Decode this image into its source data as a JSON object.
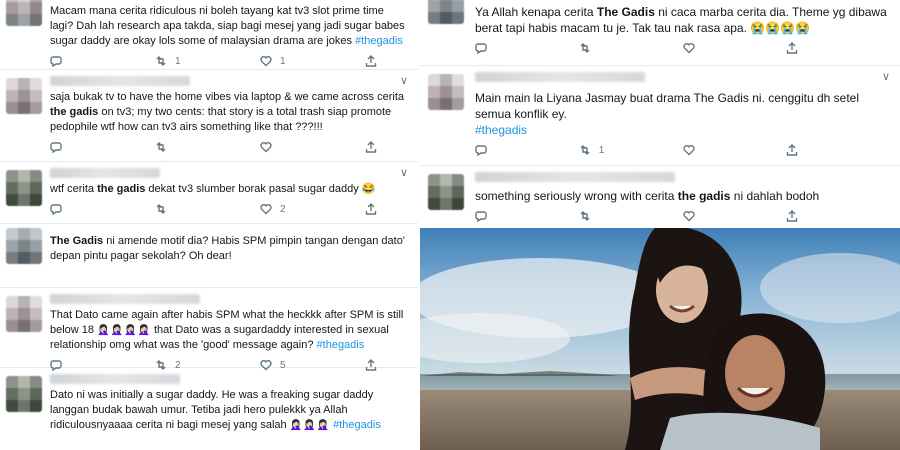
{
  "left_tweets": [
    {
      "id": "t1",
      "segments": [
        {
          "t": "Macam mana cerita ridiculous ni boleh tayang kat tv3 slot prime time lagi? Dah lah research apa takda, siap bagi mesej yang jadi sugar babes sugar daddy are okay lols some of malaysian drama are jokes ",
          "s": "plain"
        },
        {
          "t": "#thegadis",
          "s": "tag"
        }
      ],
      "retweets": "1",
      "likes": "1"
    },
    {
      "id": "t2",
      "segments": [
        {
          "t": "saja bukak tv to have the home vibes via laptop & we came across cerita ",
          "s": "plain"
        },
        {
          "t": "the gadis",
          "s": "bold"
        },
        {
          "t": " on tv3; my two cents: that story is a total trash siap promote pedophile wtf how can tv3 airs something like that ???!!!",
          "s": "plain"
        }
      ],
      "retweets": "",
      "likes": ""
    },
    {
      "id": "t3",
      "segments": [
        {
          "t": "wtf cerita ",
          "s": "plain"
        },
        {
          "t": "the gadis",
          "s": "bold"
        },
        {
          "t": " dekat tv3 slumber borak pasal sugar daddy ",
          "s": "plain"
        },
        {
          "t": "😂",
          "s": "plain"
        }
      ],
      "retweets": "",
      "likes": "2"
    },
    {
      "id": "t4",
      "segments": [
        {
          "t": "The Gadis",
          "s": "bold"
        },
        {
          "t": " ni amende motif dia? Habis SPM pimpin tangan dengan dato' depan pintu pagar sekolah? Oh dear!",
          "s": "plain"
        }
      ],
      "retweets": "",
      "likes": ""
    },
    {
      "id": "t5",
      "segments": [
        {
          "t": "That Dato came again after habis SPM what the heckkk after SPM is still below 18 ",
          "s": "plain"
        },
        {
          "t": "🤦🏻‍♀️🤦🏻‍♀️🤦🏻‍♀️🤦🏻‍♀️",
          "s": "emo"
        },
        {
          "t": " that Dato was a sugardaddy interested in sexual relationship omg what was the 'good' message again? ",
          "s": "plain"
        },
        {
          "t": "#thegadis",
          "s": "tag"
        }
      ],
      "retweets": "2",
      "likes": "5"
    },
    {
      "id": "t6",
      "segments": [
        {
          "t": "Dato ni was initially a sugar daddy. He was a freaking sugar daddy langgan budak bawah umur. Tetiba jadi hero pulekkk ya Allah ridiculousnyaaaa cerita ni bagi mesej yang salah ",
          "s": "plain"
        },
        {
          "t": "🤦🏻‍♀️🤦🏻‍♀️🤦🏻‍♀️",
          "s": "emo"
        },
        {
          "t": " ",
          "s": "plain"
        },
        {
          "t": "#thegadis",
          "s": "tag"
        }
      ],
      "retweets": "",
      "likes": ""
    }
  ],
  "right_tweets": [
    {
      "id": "r1",
      "segments": [
        {
          "t": "Ya Allah kenapa cerita ",
          "s": "plain"
        },
        {
          "t": "The Gadis",
          "s": "bold"
        },
        {
          "t": " ni caca marba cerita dia. Theme yg dibawa berat tapi habis macam tu je. Tak tau nak rasa apa. ",
          "s": "plain"
        },
        {
          "t": "😭😭😭😭",
          "s": "plain"
        }
      ],
      "retweets": "",
      "likes": ""
    },
    {
      "id": "r2",
      "segments": [
        {
          "t": "Main main la Liyana Jasmay buat drama The Gadis ni. cenggitu dh setel semua konflik ey.",
          "s": "plain"
        },
        {
          "t": "\n",
          "s": "plain"
        },
        {
          "t": "#thegadis",
          "s": "tag"
        }
      ],
      "retweets": "1",
      "likes": ""
    },
    {
      "id": "r3",
      "segments": [
        {
          "t": "something seriously wrong with cerita ",
          "s": "plain"
        },
        {
          "t": "the gadis",
          "s": "bold"
        },
        {
          "t": " ni dahlah bodoh",
          "s": "plain"
        }
      ],
      "retweets": "",
      "likes": ""
    }
  ],
  "icons": {
    "reply": "reply-icon",
    "retweet": "retweet-icon",
    "like": "heart-icon",
    "share": "share-icon",
    "menu": "chevron-down-icon"
  },
  "colors": {
    "hashtag": "#1b95e0",
    "meta": "#657786",
    "divider": "#e6ecf0"
  }
}
